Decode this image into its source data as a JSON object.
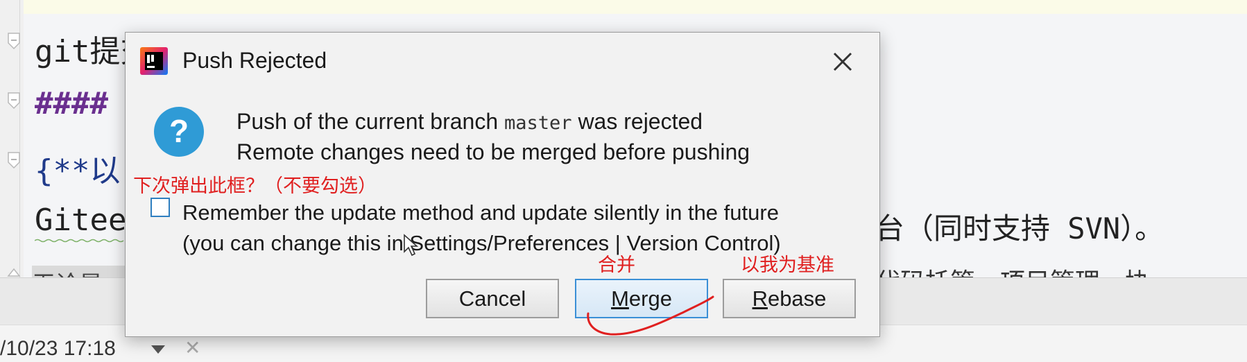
{
  "editor": {
    "lines": [
      {
        "text": "git提交笔记"
      },
      {
        "text": "####"
      },
      {
        "text": "{**以"
      },
      {
        "text": "Gitee"
      }
    ],
    "right_text": "台（同时支持 SVN）。",
    "right_text2": "代码托管、项目管理、协",
    "strip_text": "无论是",
    "timestamp": "/10/23 17:18"
  },
  "dialog": {
    "title": "Push Rejected",
    "message_line1_prefix": "Push of the current branch ",
    "branch": "master",
    "message_line1_suffix": " was rejected",
    "message_line2": "Remote changes need to be merged before pushing",
    "checkbox_label_line1": "Remember the update method and update silently in the future",
    "checkbox_label_line2": "(you can change this in Settings/Preferences | Version Control)",
    "checkbox_checked": false,
    "buttons": {
      "cancel": "Cancel",
      "merge_mnemonic": "M",
      "merge_rest": "erge",
      "rebase_mnemonic": "R",
      "rebase_rest": "ebase"
    },
    "icons": {
      "app": "intellij-icon",
      "close": "close-icon",
      "question": "question-icon"
    },
    "colors": {
      "question": "#2f9bd6",
      "default_button_border": "#3a8fd6"
    }
  },
  "annotations": {
    "checkbox_note": "下次弹出此框？（不要勾选）",
    "merge_note": "合并",
    "rebase_note": "以我为基准",
    "color": "#e02020"
  }
}
